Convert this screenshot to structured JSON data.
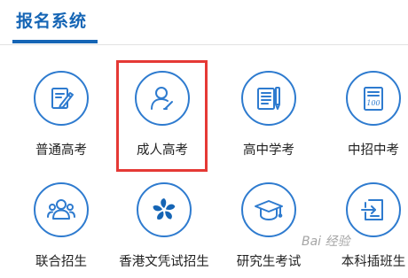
{
  "header": {
    "title": "报名系统"
  },
  "tiles": [
    {
      "label": "普通高考",
      "icon": "exam-paper-pencil-icon"
    },
    {
      "label": "成人高考",
      "icon": "user-icon"
    },
    {
      "label": "高中学考",
      "icon": "book-pencil-icon"
    },
    {
      "label": "中招中考",
      "icon": "score-sheet-icon"
    },
    {
      "label": "联合招生",
      "icon": "group-users-icon"
    },
    {
      "label": "香港文凭试招生",
      "icon": "bauhinia-flower-icon"
    },
    {
      "label": "研究生考试",
      "icon": "graduation-cap-icon"
    },
    {
      "label": "本科插班生",
      "icon": "transfer-document-icon"
    }
  ],
  "icon_texts": {
    "score_sheet": "100"
  },
  "watermark": {
    "text": "Bai 经验"
  },
  "colors": {
    "accent": "#1565b5",
    "icon_stroke": "#2e7bcf",
    "highlight": "#e53935"
  }
}
